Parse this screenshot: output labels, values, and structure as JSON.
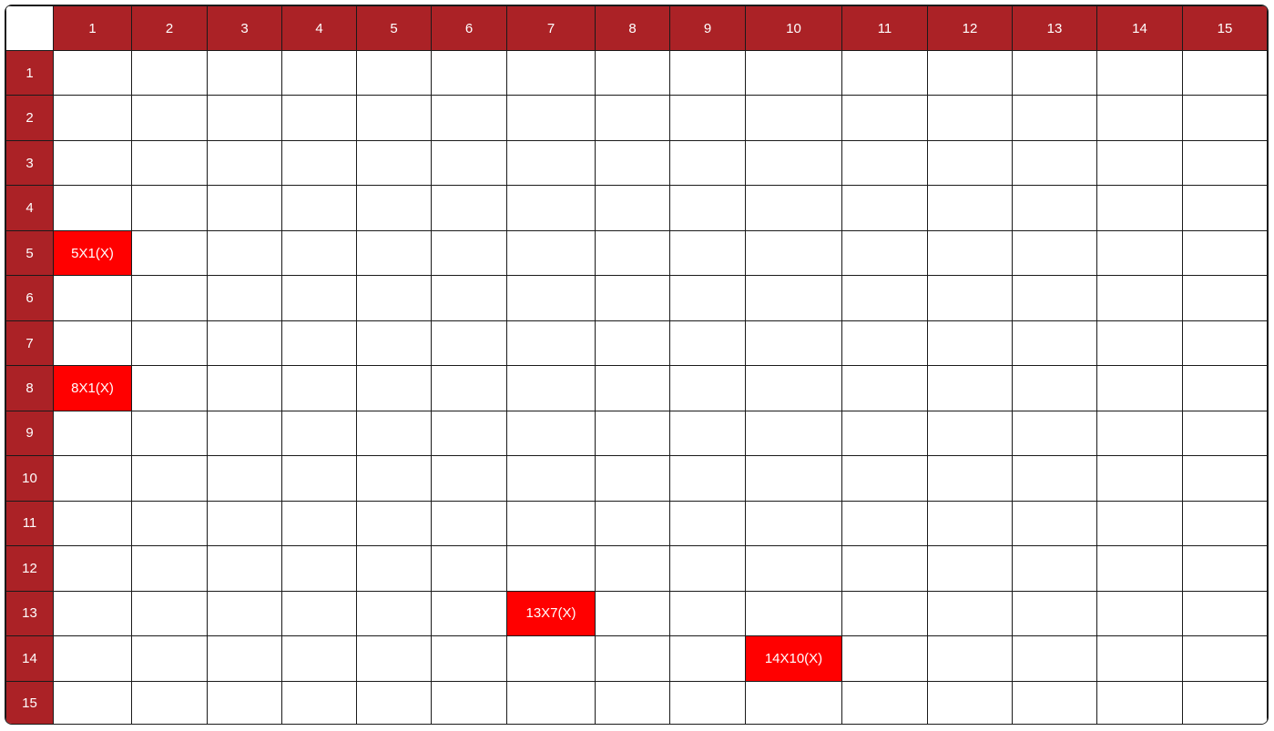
{
  "grid": {
    "columns": [
      "1",
      "2",
      "3",
      "4",
      "5",
      "6",
      "7",
      "8",
      "9",
      "10",
      "11",
      "12",
      "13",
      "14",
      "15"
    ],
    "rows": [
      "1",
      "2",
      "3",
      "4",
      "5",
      "6",
      "7",
      "8",
      "9",
      "10",
      "11",
      "12",
      "13",
      "14",
      "15"
    ],
    "marked_cells": [
      {
        "row": 5,
        "col": 1,
        "label": "5X1(X)"
      },
      {
        "row": 8,
        "col": 1,
        "label": "8X1(X)"
      },
      {
        "row": 13,
        "col": 7,
        "label": "13X7(X)"
      },
      {
        "row": 14,
        "col": 10,
        "label": "14X10(X)"
      }
    ]
  },
  "colors": {
    "header_bg": "#ab2226",
    "marked_bg": "#ff0000",
    "grid_line": "#1a1a1a"
  }
}
